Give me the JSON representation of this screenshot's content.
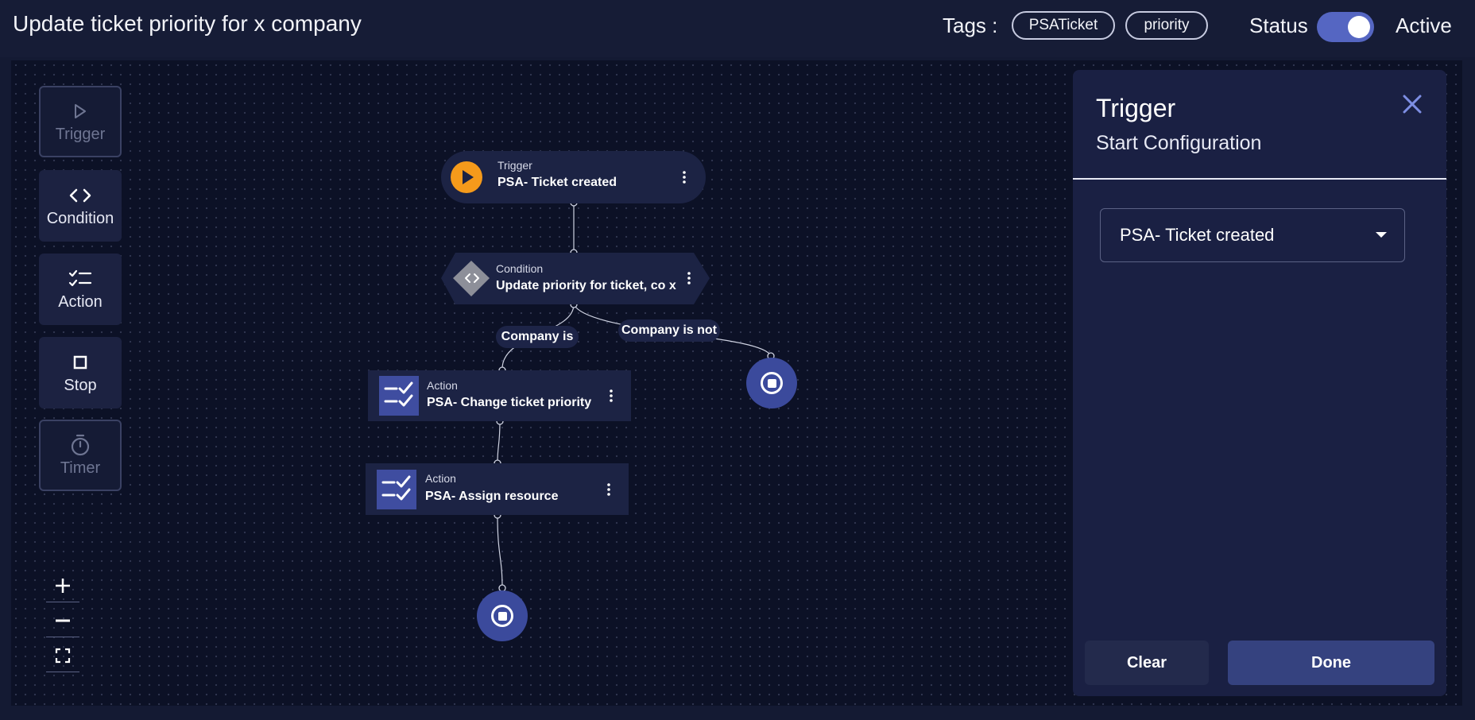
{
  "header": {
    "title": "Update ticket priority for x company",
    "tags_label": "Tags :",
    "tags": [
      "PSATicket",
      "priority"
    ],
    "status_label": "Status",
    "status_on": true,
    "status_value": "Active"
  },
  "palette": {
    "items": [
      {
        "label": "Trigger",
        "icon": "play-icon",
        "enabled": false
      },
      {
        "label": "Condition",
        "icon": "code-icon",
        "enabled": true
      },
      {
        "label": "Action",
        "icon": "checklist-icon",
        "enabled": true
      },
      {
        "label": "Stop",
        "icon": "stop-icon",
        "enabled": true
      },
      {
        "label": "Timer",
        "icon": "stopwatch-icon",
        "enabled": false
      }
    ]
  },
  "zoom_controls": [
    "zoom-in-icon",
    "zoom-out-icon",
    "fit-view-icon"
  ],
  "flow": {
    "trigger": {
      "type": "Trigger",
      "title": "PSA- Ticket created"
    },
    "condition": {
      "type": "Condition",
      "title": "Update priority for ticket, co x"
    },
    "edges": {
      "true_label": "Company is",
      "false_label": "Company is not"
    },
    "actions": [
      {
        "type": "Action",
        "title": "PSA- Change ticket priority"
      },
      {
        "type": "Action",
        "title": "PSA- Assign resource"
      }
    ]
  },
  "panel": {
    "title": "Trigger",
    "subtitle": "Start Configuration",
    "selected_trigger": "PSA- Ticket created",
    "clear_label": "Clear",
    "done_label": "Done"
  },
  "colors": {
    "background": "#141a33",
    "canvas": "#0c1126",
    "node": "#1c2344",
    "accent": "#5566c2",
    "trigger_orange": "#f59a1b",
    "stop_blue": "#3b4a9c"
  }
}
